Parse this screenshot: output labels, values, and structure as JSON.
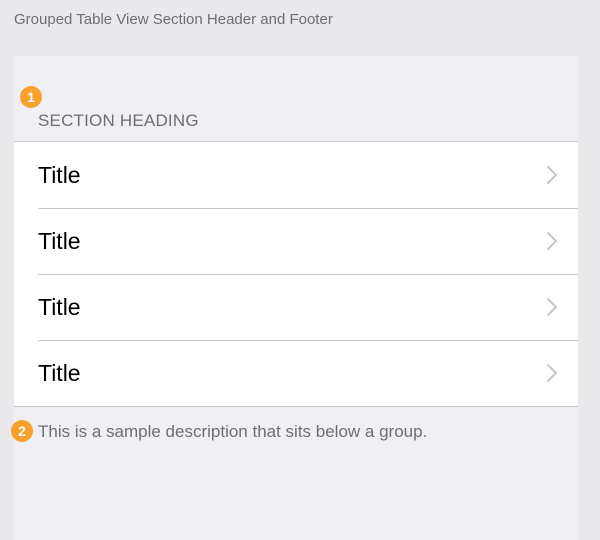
{
  "page": {
    "caption": "Grouped Table View Section Header and Footer"
  },
  "annotations": [
    {
      "number": "1",
      "color": "#f7a12a"
    },
    {
      "number": "2",
      "color": "#f7a12a"
    }
  ],
  "table": {
    "section_heading": "SECTION HEADING",
    "rows": [
      {
        "title": "Title",
        "accessory": "chevron-right-icon"
      },
      {
        "title": "Title",
        "accessory": "chevron-right-icon"
      },
      {
        "title": "Title",
        "accessory": "chevron-right-icon"
      },
      {
        "title": "Title",
        "accessory": "chevron-right-icon"
      }
    ],
    "section_footer": "This is a sample description that sits below a group."
  },
  "colors": {
    "background": "#e9e9ec",
    "table_background": "#efeff4",
    "cell_background": "#ffffff",
    "separator": "#c8c7cc",
    "secondary_text": "#6d6d72",
    "chevron": "#c7c7cc",
    "badge": "#f7a12a"
  }
}
